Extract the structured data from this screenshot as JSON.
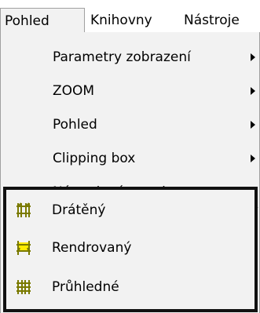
{
  "menubar": {
    "items": [
      {
        "label": "Pohled"
      },
      {
        "label": "Knihovny"
      },
      {
        "label": "Nástroje"
      }
    ]
  },
  "menu": {
    "items": [
      {
        "label": "Parametry zobrazení",
        "has_submenu": true
      },
      {
        "label": "ZOOM",
        "has_submenu": true
      },
      {
        "label": "Pohled",
        "has_submenu": true
      },
      {
        "label": "Clipping box",
        "has_submenu": true
      },
      {
        "label": "Nástrojové panely",
        "has_submenu": true
      }
    ],
    "view_modes": [
      {
        "label": "Drátěný",
        "icon": "wireframe-icon"
      },
      {
        "label": "Rendrovaný",
        "icon": "rendered-icon"
      },
      {
        "label": "Průhledné",
        "icon": "transparent-icon"
      }
    ]
  },
  "colors": {
    "icon_olive": "#7a7a00",
    "icon_yellow": "#ffeb00",
    "menu_bg": "#f2f2f2",
    "highlight_border": "#111111"
  }
}
